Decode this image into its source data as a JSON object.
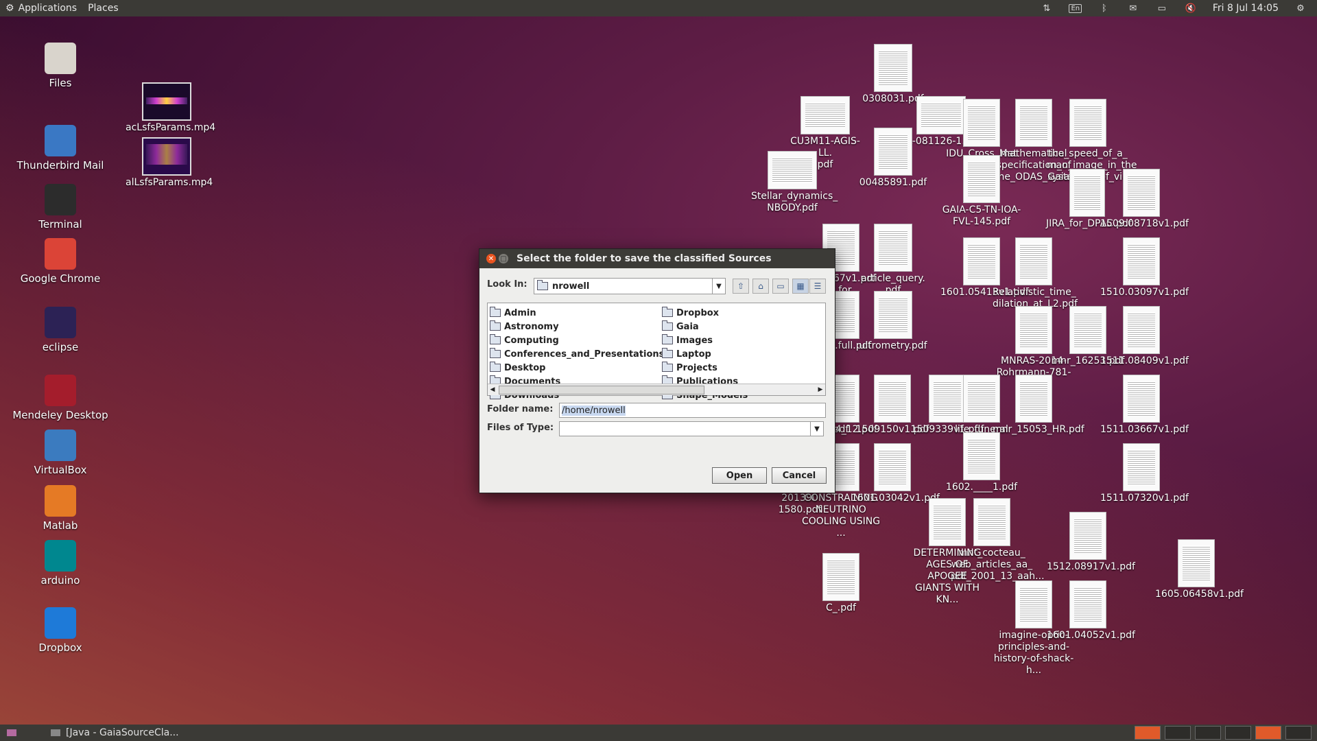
{
  "top_panel": {
    "applications": "Applications",
    "places": "Places",
    "keyboard_layout": "En",
    "clock": "Fri 8 Jul 14:05"
  },
  "launchers": [
    {
      "label": "Files",
      "icon": "files-icon",
      "color": "#d9d4cc"
    },
    {
      "label": "Thunderbird Mail",
      "icon": "thunderbird-icon",
      "color": "#3a78c4"
    },
    {
      "label": "Terminal",
      "icon": "terminal-icon",
      "color": "#2c2c2c"
    },
    {
      "label": "Google Chrome",
      "icon": "chrome-icon",
      "color": "#db4437"
    },
    {
      "label": "eclipse",
      "icon": "eclipse-icon",
      "color": "#2c2255"
    },
    {
      "label": "Mendeley Desktop",
      "icon": "mendeley-icon",
      "color": "#a41d2c"
    },
    {
      "label": "VirtualBox",
      "icon": "virtualbox-icon",
      "color": "#3b7bbf"
    },
    {
      "label": "Matlab",
      "icon": "matlab-icon",
      "color": "#e57a25"
    },
    {
      "label": "arduino",
      "icon": "arduino-icon",
      "color": "#00878f"
    },
    {
      "label": "Dropbox",
      "icon": "dropbox-icon",
      "color": "#1e7ad8"
    }
  ],
  "videos": [
    {
      "label": "acLsfsParams.mp4"
    },
    {
      "label": "alLsfsParams.mp4"
    }
  ],
  "desktop_files": [
    {
      "label": "0308031.pdf"
    },
    {
      "label": "CU3M11-AGIS-LL.\npdf"
    },
    {
      "label": "LL-081126-1.pdf"
    },
    {
      "label": "IDU_Cross_Mat\nDe"
    },
    {
      "label": "mathematical\nspecification_of\nthe_ODAS_syste"
    },
    {
      "label": "the_speed_of_a_\nman_image_in_the\nGaia_field_of_vie"
    },
    {
      "label": "00485891.pdf"
    },
    {
      "label": "Stellar_dynamics_\nNBODY.pdf"
    },
    {
      "label": "GAIA-C5-TN-IOA-\nFVL-145.pdf"
    },
    {
      "label": "JIRA_for_DPAC.pdf"
    },
    {
      "label": "1509.08718v1.pdf"
    },
    {
      "label": "1510.03097v1.pdf"
    },
    {
      "label": "d.00967v1.pdf\ns for\ns a..."
    },
    {
      "label": "article_query.\npdf"
    },
    {
      "label": "1601.05413v1.pdf"
    },
    {
      "label": "Relativistic_time_\ndilation_at_L2.pdf"
    },
    {
      "label": "3274.full.pdf"
    },
    {
      "label": "ultrometry.pdf"
    },
    {
      "label": "MNRAS-2014-\nRohrmann-781-91."
    },
    {
      "label": "mnr_16253.pdf"
    },
    {
      "label": "1511.08409v1.pdf"
    },
    {
      "label": "pdf"
    },
    {
      "label": "123344_12.pdf"
    },
    {
      "label": "1509150v1.pdf"
    },
    {
      "label": "1509339v1.pdf"
    },
    {
      "label": "life_funeral"
    },
    {
      "label": "mnr_15053_HR.pdf"
    },
    {
      "label": "1511.03667v1.pdf"
    },
    {
      "label": "201390 1580.pdf"
    },
    {
      "label": "CONSTRAINING\nNEUTRINO\nCOOLING USING ..."
    },
    {
      "label": "1601.03042v1.pdf"
    },
    {
      "label": "1602.____1.pdf"
    },
    {
      "label": "1511.07320v1.pdf"
    },
    {
      "label": "mnt_cocteau_\nweb_articles_aa_\npdf_2001_13_aah..."
    },
    {
      "label": "DETERMINING\nAGES OF APOGEE\nGIANTS WITH KN..."
    },
    {
      "label": "1512.08917v1.pdf"
    },
    {
      "label": "C_.pdf"
    },
    {
      "label": "1605.06458v1.pdf"
    },
    {
      "label": "imagine-optic-\nprinciples-and-\nhistory-of-shack-h..."
    },
    {
      "label": "1601.04052v1.pdf"
    }
  ],
  "dialog": {
    "title": "Select the folder to save the classified Sources",
    "look_in_label": "Look In:",
    "look_in_value": "nrowell",
    "folders_left": [
      "Admin",
      "Astronomy",
      "Computing",
      "Conferences_and_Presentations",
      "Desktop",
      "Documents",
      "Downloads"
    ],
    "folders_right": [
      "Dropbox",
      "Gaia",
      "Images",
      "Laptop",
      "Projects",
      "Publications",
      "Shape_Models"
    ],
    "folder_name_label": "Folder name:",
    "folder_name_value": "/home/nrowell",
    "files_of_type_label": "Files of Type:",
    "files_of_type_value": "",
    "open_button": "Open",
    "cancel_button": "Cancel"
  },
  "taskbar": {
    "window_item": "[Java - GaiaSourceCla..."
  },
  "colors": {
    "accent": "#e95420",
    "panel": "#3b3a36"
  }
}
